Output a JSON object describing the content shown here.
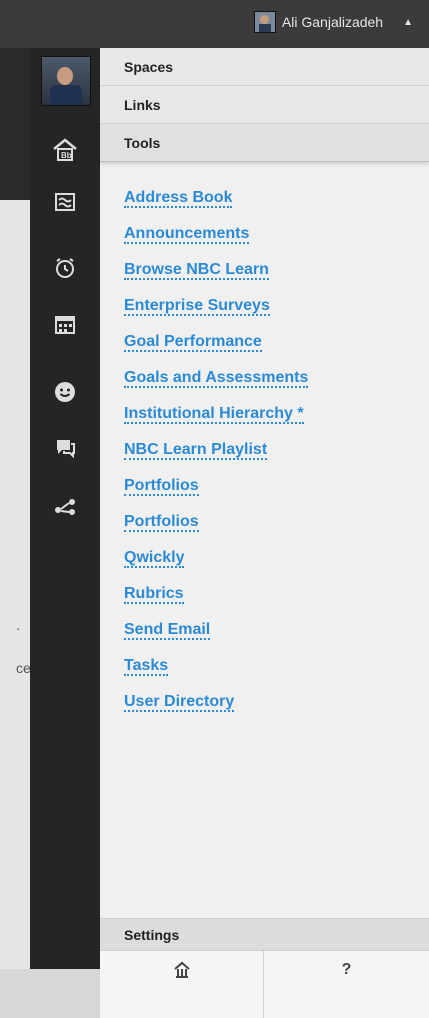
{
  "topbar": {
    "user_name": "Ali Ganjalizadeh",
    "caret": "▲"
  },
  "sections": {
    "spaces": "Spaces",
    "links": "Links",
    "tools": "Tools"
  },
  "tools": [
    "Address Book",
    "Announcements",
    "Browse NBC Learn",
    "Enterprise Surveys",
    "Goal Performance",
    "Goals and Assessments",
    "Institutional Hierarchy *",
    "NBC Learn Playlist",
    "Portfolios",
    "Portfolios",
    "Qwickly",
    "Rubrics",
    "Send Email",
    "Tasks",
    "User Directory"
  ],
  "settings_label": "Settings",
  "bottom": {
    "help_label": "?"
  },
  "background_fragments": [
    "·",
    "ce"
  ],
  "colors": {
    "link": "#2b8ad6",
    "rail_bg": "#252525",
    "panel_bg": "#f0f0f0"
  },
  "icons": {
    "rail": [
      "user-avatar",
      "blackboard-home-icon",
      "stream-icon",
      "alarm-clock-icon",
      "calendar-icon",
      "smiley-icon",
      "chat-icon",
      "network-icon"
    ],
    "bottom": [
      "home-icon",
      "help-icon"
    ]
  }
}
